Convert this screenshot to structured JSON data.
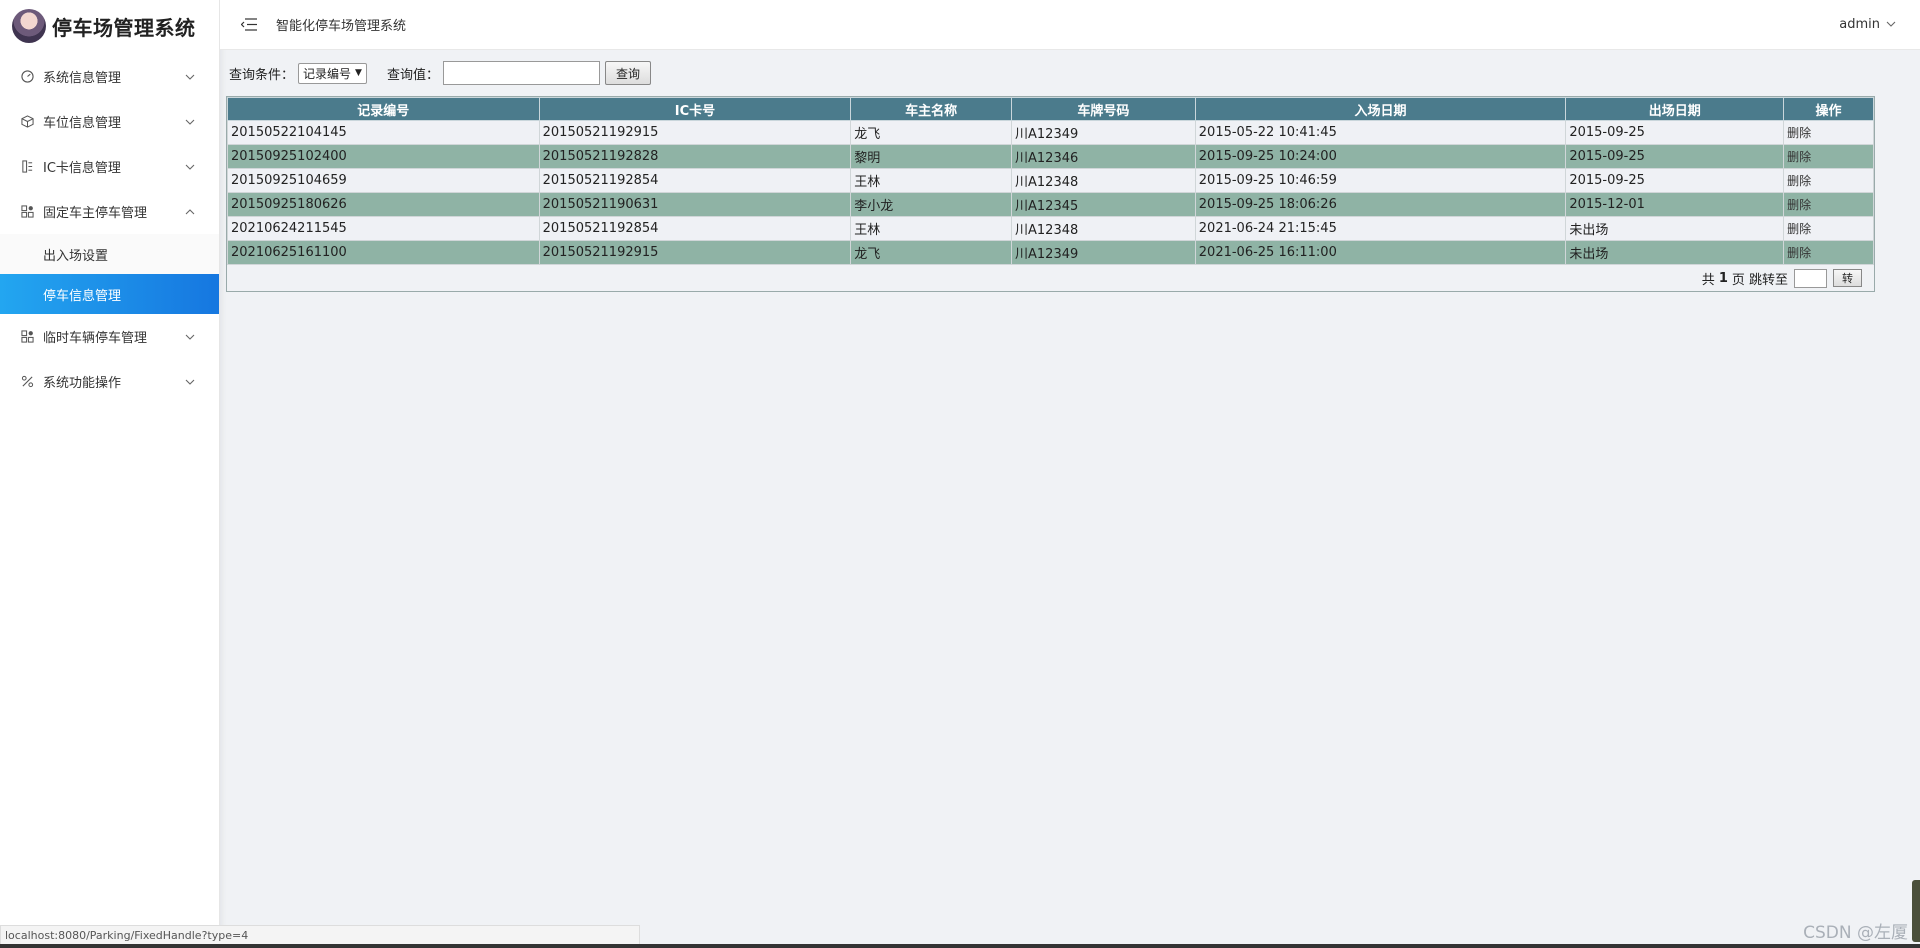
{
  "app": {
    "title": "停车场管理系统"
  },
  "sidebar": {
    "items": [
      {
        "label": "系统信息管理",
        "icon": "dashboard-icon",
        "expanded": false
      },
      {
        "label": "车位信息管理",
        "icon": "cube-icon",
        "expanded": false
      },
      {
        "label": "IC卡信息管理",
        "icon": "card-icon",
        "expanded": false
      },
      {
        "label": "固定车主停车管理",
        "icon": "grid-icon",
        "expanded": true,
        "children": [
          {
            "label": "出入场设置",
            "active": false
          },
          {
            "label": "停车信息管理",
            "active": true
          }
        ]
      },
      {
        "label": "临时车辆停车管理",
        "icon": "grid-icon",
        "expanded": false
      },
      {
        "label": "系统功能操作",
        "icon": "tools-icon",
        "expanded": false
      }
    ]
  },
  "header": {
    "title": "智能化停车场管理系统",
    "user": "admin"
  },
  "query": {
    "condition_label": "查询条件：",
    "condition_value": "记录编号",
    "value_label": "查询值：",
    "input_value": "",
    "button": "查询"
  },
  "table": {
    "columns": [
      "记录编号",
      "IC卡号",
      "车主名称",
      "车牌号码",
      "入场日期",
      "出场日期",
      "操作"
    ],
    "rows": [
      [
        "20150522104145",
        "20150521192915",
        "龙飞",
        "川A12349",
        "2015-05-22 10:41:45",
        "2015-09-25",
        "删除"
      ],
      [
        "20150925102400",
        "20150521192828",
        "黎明",
        "川A12346",
        "2015-09-25 10:24:00",
        "2015-09-25",
        "删除"
      ],
      [
        "20150925104659",
        "20150521192854",
        "王林",
        "川A12348",
        "2015-09-25 10:46:59",
        "2015-09-25",
        "删除"
      ],
      [
        "20150925180626",
        "20150521190631",
        "李小龙",
        "川A12345",
        "2015-09-25 18:06:26",
        "2015-12-01",
        "删除"
      ],
      [
        "20210624211545",
        "20150521192854",
        "王林",
        "川A12348",
        "2021-06-24 21:15:45",
        "未出场",
        "删除"
      ],
      [
        "20210625161100",
        "20150521192915",
        "龙飞",
        "川A12349",
        "2021-06-25 16:11:00",
        "未出场",
        "删除"
      ]
    ]
  },
  "pager": {
    "prefix": "共",
    "total_pages": "1",
    "suffix": "页 跳转至",
    "go_button": "转"
  },
  "status_bar": {
    "url": "localhost:8080/Parking/FixedHandle?type=4"
  },
  "watermark": "CSDN @左厦",
  "colors": {
    "table_header": "#4b7b8c",
    "row_odd": "#eff1f5",
    "row_even": "#8fb3a5",
    "menu_active": "#1677e0"
  }
}
